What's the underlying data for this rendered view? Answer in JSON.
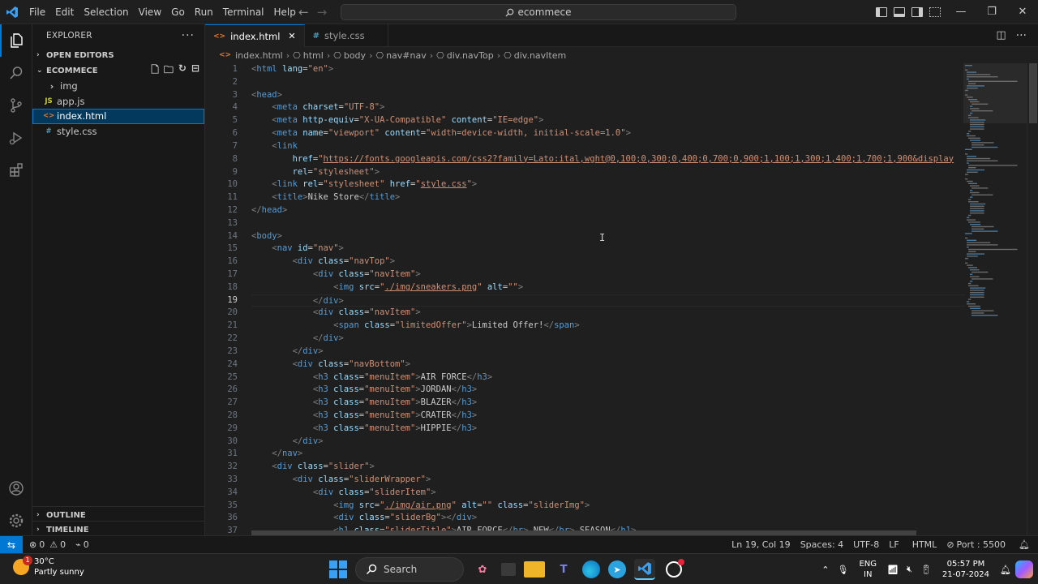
{
  "titlebar": {
    "menu": [
      "File",
      "Edit",
      "Selection",
      "View",
      "Go",
      "Run",
      "Terminal",
      "Help"
    ],
    "search_text": "ecommece",
    "window_controls": [
      "minimize-icon",
      "restore-icon",
      "close-icon"
    ]
  },
  "activity_bar": [
    "explorer-icon",
    "search-icon",
    "source-control-icon",
    "run-debug-icon",
    "extensions-icon",
    "account-icon",
    "settings-gear-icon"
  ],
  "sidebar": {
    "title": "EXPLORER",
    "open_editors": "OPEN EDITORS",
    "project": "ECOMMECE",
    "files": [
      {
        "name": "img",
        "kind": "folder"
      },
      {
        "name": "app.js",
        "kind": "js",
        "icon": "JS"
      },
      {
        "name": "index.html",
        "kind": "html",
        "icon": "<>"
      },
      {
        "name": "style.css",
        "kind": "css",
        "icon": "#"
      }
    ],
    "outline": "OUTLINE",
    "timeline": "TIMELINE"
  },
  "tabs": [
    {
      "label": "index.html",
      "icon": "<>",
      "active": true
    },
    {
      "label": "style.css",
      "icon": "#",
      "active": false
    }
  ],
  "breadcrumb": [
    "index.html",
    "html",
    "body",
    "nav#nav",
    "div.navTop",
    "div.navItem"
  ],
  "editor": {
    "current_line": 19,
    "lines": [
      [
        [
          "t",
          "<"
        ],
        [
          "n",
          "html"
        ],
        [
          "x",
          " "
        ],
        [
          "a",
          "lang"
        ],
        [
          "x",
          "="
        ],
        [
          "s",
          "\"en\""
        ],
        [
          "t",
          ">"
        ]
      ],
      [],
      [
        [
          "t",
          "<"
        ],
        [
          "n",
          "head"
        ],
        [
          "t",
          ">"
        ]
      ],
      [
        [
          "x",
          "    "
        ],
        [
          "t",
          "<"
        ],
        [
          "n",
          "meta"
        ],
        [
          "x",
          " "
        ],
        [
          "a",
          "charset"
        ],
        [
          "x",
          "="
        ],
        [
          "s",
          "\"UTF-8\""
        ],
        [
          "t",
          ">"
        ]
      ],
      [
        [
          "x",
          "    "
        ],
        [
          "t",
          "<"
        ],
        [
          "n",
          "meta"
        ],
        [
          "x",
          " "
        ],
        [
          "a",
          "http-equiv"
        ],
        [
          "x",
          "="
        ],
        [
          "s",
          "\"X-UA-Compatible\""
        ],
        [
          "x",
          " "
        ],
        [
          "a",
          "content"
        ],
        [
          "x",
          "="
        ],
        [
          "s",
          "\"IE=edge\""
        ],
        [
          "t",
          ">"
        ]
      ],
      [
        [
          "x",
          "    "
        ],
        [
          "t",
          "<"
        ],
        [
          "n",
          "meta"
        ],
        [
          "x",
          " "
        ],
        [
          "a",
          "name"
        ],
        [
          "x",
          "="
        ],
        [
          "s",
          "\"viewport\""
        ],
        [
          "x",
          " "
        ],
        [
          "a",
          "content"
        ],
        [
          "x",
          "="
        ],
        [
          "s",
          "\"width=device-width, initial-scale=1.0\""
        ],
        [
          "t",
          ">"
        ]
      ],
      [
        [
          "x",
          "    "
        ],
        [
          "t",
          "<"
        ],
        [
          "n",
          "link"
        ]
      ],
      [
        [
          "x",
          "        "
        ],
        [
          "a",
          "href"
        ],
        [
          "x",
          "="
        ],
        [
          "s",
          "\""
        ],
        [
          "u",
          "https://fonts.googleapis.com/css2?family=Lato:ital,wght@0,100;0,300;0,400;0,700;0,900;1,100;1,300;1,400;1,700;1,900&display"
        ]
      ],
      [
        [
          "x",
          "        "
        ],
        [
          "a",
          "rel"
        ],
        [
          "x",
          "="
        ],
        [
          "s",
          "\"stylesheet\""
        ],
        [
          "t",
          ">"
        ]
      ],
      [
        [
          "x",
          "    "
        ],
        [
          "t",
          "<"
        ],
        [
          "n",
          "link"
        ],
        [
          "x",
          " "
        ],
        [
          "a",
          "rel"
        ],
        [
          "x",
          "="
        ],
        [
          "s",
          "\"stylesheet\""
        ],
        [
          "x",
          " "
        ],
        [
          "a",
          "href"
        ],
        [
          "x",
          "="
        ],
        [
          "s",
          "\""
        ],
        [
          "u",
          "style.css"
        ],
        [
          "s",
          "\""
        ],
        [
          "t",
          ">"
        ]
      ],
      [
        [
          "x",
          "    "
        ],
        [
          "t",
          "<"
        ],
        [
          "n",
          "title"
        ],
        [
          "t",
          ">"
        ],
        [
          "x",
          "Nike Store"
        ],
        [
          "t",
          "</"
        ],
        [
          "n",
          "title"
        ],
        [
          "t",
          ">"
        ]
      ],
      [
        [
          "t",
          "</"
        ],
        [
          "n",
          "head"
        ],
        [
          "t",
          ">"
        ]
      ],
      [],
      [
        [
          "t",
          "<"
        ],
        [
          "n",
          "body"
        ],
        [
          "t",
          ">"
        ]
      ],
      [
        [
          "x",
          "    "
        ],
        [
          "t",
          "<"
        ],
        [
          "n",
          "nav"
        ],
        [
          "x",
          " "
        ],
        [
          "a",
          "id"
        ],
        [
          "x",
          "="
        ],
        [
          "s",
          "\"nav\""
        ],
        [
          "t",
          ">"
        ]
      ],
      [
        [
          "x",
          "        "
        ],
        [
          "t",
          "<"
        ],
        [
          "n",
          "div"
        ],
        [
          "x",
          " "
        ],
        [
          "a",
          "class"
        ],
        [
          "x",
          "="
        ],
        [
          "s",
          "\"navTop\""
        ],
        [
          "t",
          ">"
        ]
      ],
      [
        [
          "x",
          "            "
        ],
        [
          "t",
          "<"
        ],
        [
          "n",
          "div"
        ],
        [
          "x",
          " "
        ],
        [
          "a",
          "class"
        ],
        [
          "x",
          "="
        ],
        [
          "s",
          "\"navItem\""
        ],
        [
          "t",
          ">"
        ]
      ],
      [
        [
          "x",
          "                "
        ],
        [
          "t",
          "<"
        ],
        [
          "n",
          "img"
        ],
        [
          "x",
          " "
        ],
        [
          "a",
          "src"
        ],
        [
          "x",
          "="
        ],
        [
          "s",
          "\""
        ],
        [
          "u",
          "./img/sneakers.png"
        ],
        [
          "s",
          "\""
        ],
        [
          "x",
          " "
        ],
        [
          "a",
          "alt"
        ],
        [
          "x",
          "="
        ],
        [
          "s",
          "\"\""
        ],
        [
          "t",
          ">"
        ]
      ],
      [
        [
          "x",
          "            "
        ],
        [
          "t",
          "</"
        ],
        [
          "n",
          "div"
        ],
        [
          "t",
          ">"
        ]
      ],
      [
        [
          "x",
          "            "
        ],
        [
          "t",
          "<"
        ],
        [
          "n",
          "div"
        ],
        [
          "x",
          " "
        ],
        [
          "a",
          "class"
        ],
        [
          "x",
          "="
        ],
        [
          "s",
          "\"navItem\""
        ],
        [
          "t",
          ">"
        ]
      ],
      [
        [
          "x",
          "                "
        ],
        [
          "t",
          "<"
        ],
        [
          "n",
          "span"
        ],
        [
          "x",
          " "
        ],
        [
          "a",
          "class"
        ],
        [
          "x",
          "="
        ],
        [
          "s",
          "\"limitedOffer\""
        ],
        [
          "t",
          ">"
        ],
        [
          "x",
          "Limited Offer!"
        ],
        [
          "t",
          "</"
        ],
        [
          "n",
          "span"
        ],
        [
          "t",
          ">"
        ]
      ],
      [
        [
          "x",
          "            "
        ],
        [
          "t",
          "</"
        ],
        [
          "n",
          "div"
        ],
        [
          "t",
          ">"
        ]
      ],
      [
        [
          "x",
          "        "
        ],
        [
          "t",
          "</"
        ],
        [
          "n",
          "div"
        ],
        [
          "t",
          ">"
        ]
      ],
      [
        [
          "x",
          "        "
        ],
        [
          "t",
          "<"
        ],
        [
          "n",
          "div"
        ],
        [
          "x",
          " "
        ],
        [
          "a",
          "class"
        ],
        [
          "x",
          "="
        ],
        [
          "s",
          "\"navBottom\""
        ],
        [
          "t",
          ">"
        ]
      ],
      [
        [
          "x",
          "            "
        ],
        [
          "t",
          "<"
        ],
        [
          "n",
          "h3"
        ],
        [
          "x",
          " "
        ],
        [
          "a",
          "class"
        ],
        [
          "x",
          "="
        ],
        [
          "s",
          "\"menuItem\""
        ],
        [
          "t",
          ">"
        ],
        [
          "x",
          "AIR FORCE"
        ],
        [
          "t",
          "</"
        ],
        [
          "n",
          "h3"
        ],
        [
          "t",
          ">"
        ]
      ],
      [
        [
          "x",
          "            "
        ],
        [
          "t",
          "<"
        ],
        [
          "n",
          "h3"
        ],
        [
          "x",
          " "
        ],
        [
          "a",
          "class"
        ],
        [
          "x",
          "="
        ],
        [
          "s",
          "\"menuItem\""
        ],
        [
          "t",
          ">"
        ],
        [
          "x",
          "JORDAN"
        ],
        [
          "t",
          "</"
        ],
        [
          "n",
          "h3"
        ],
        [
          "t",
          ">"
        ]
      ],
      [
        [
          "x",
          "            "
        ],
        [
          "t",
          "<"
        ],
        [
          "n",
          "h3"
        ],
        [
          "x",
          " "
        ],
        [
          "a",
          "class"
        ],
        [
          "x",
          "="
        ],
        [
          "s",
          "\"menuItem\""
        ],
        [
          "t",
          ">"
        ],
        [
          "x",
          "BLAZER"
        ],
        [
          "t",
          "</"
        ],
        [
          "n",
          "h3"
        ],
        [
          "t",
          ">"
        ]
      ],
      [
        [
          "x",
          "            "
        ],
        [
          "t",
          "<"
        ],
        [
          "n",
          "h3"
        ],
        [
          "x",
          " "
        ],
        [
          "a",
          "class"
        ],
        [
          "x",
          "="
        ],
        [
          "s",
          "\"menuItem\""
        ],
        [
          "t",
          ">"
        ],
        [
          "x",
          "CRATER"
        ],
        [
          "t",
          "</"
        ],
        [
          "n",
          "h3"
        ],
        [
          "t",
          ">"
        ]
      ],
      [
        [
          "x",
          "            "
        ],
        [
          "t",
          "<"
        ],
        [
          "n",
          "h3"
        ],
        [
          "x",
          " "
        ],
        [
          "a",
          "class"
        ],
        [
          "x",
          "="
        ],
        [
          "s",
          "\"menuItem\""
        ],
        [
          "t",
          ">"
        ],
        [
          "x",
          "HIPPIE"
        ],
        [
          "t",
          "</"
        ],
        [
          "n",
          "h3"
        ],
        [
          "t",
          ">"
        ]
      ],
      [
        [
          "x",
          "        "
        ],
        [
          "t",
          "</"
        ],
        [
          "n",
          "div"
        ],
        [
          "t",
          ">"
        ]
      ],
      [
        [
          "x",
          "    "
        ],
        [
          "t",
          "</"
        ],
        [
          "n",
          "nav"
        ],
        [
          "t",
          ">"
        ]
      ],
      [
        [
          "x",
          "    "
        ],
        [
          "t",
          "<"
        ],
        [
          "n",
          "div"
        ],
        [
          "x",
          " "
        ],
        [
          "a",
          "class"
        ],
        [
          "x",
          "="
        ],
        [
          "s",
          "\"slider\""
        ],
        [
          "t",
          ">"
        ]
      ],
      [
        [
          "x",
          "        "
        ],
        [
          "t",
          "<"
        ],
        [
          "n",
          "div"
        ],
        [
          "x",
          " "
        ],
        [
          "a",
          "class"
        ],
        [
          "x",
          "="
        ],
        [
          "s",
          "\"sliderWrapper\""
        ],
        [
          "t",
          ">"
        ]
      ],
      [
        [
          "x",
          "            "
        ],
        [
          "t",
          "<"
        ],
        [
          "n",
          "div"
        ],
        [
          "x",
          " "
        ],
        [
          "a",
          "class"
        ],
        [
          "x",
          "="
        ],
        [
          "s",
          "\"sliderItem\""
        ],
        [
          "t",
          ">"
        ]
      ],
      [
        [
          "x",
          "                "
        ],
        [
          "t",
          "<"
        ],
        [
          "n",
          "img"
        ],
        [
          "x",
          " "
        ],
        [
          "a",
          "src"
        ],
        [
          "x",
          "="
        ],
        [
          "s",
          "\""
        ],
        [
          "u",
          "./img/air.png"
        ],
        [
          "s",
          "\""
        ],
        [
          "x",
          " "
        ],
        [
          "a",
          "alt"
        ],
        [
          "x",
          "="
        ],
        [
          "s",
          "\"\""
        ],
        [
          "x",
          " "
        ],
        [
          "a",
          "class"
        ],
        [
          "x",
          "="
        ],
        [
          "s",
          "\"sliderImg\""
        ],
        [
          "t",
          ">"
        ]
      ],
      [
        [
          "x",
          "                "
        ],
        [
          "t",
          "<"
        ],
        [
          "n",
          "div"
        ],
        [
          "x",
          " "
        ],
        [
          "a",
          "class"
        ],
        [
          "x",
          "="
        ],
        [
          "s",
          "\"sliderBg\""
        ],
        [
          "t",
          "></"
        ],
        [
          "n",
          "div"
        ],
        [
          "t",
          ">"
        ]
      ],
      [
        [
          "x",
          "                "
        ],
        [
          "t",
          "<"
        ],
        [
          "n",
          "h1"
        ],
        [
          "x",
          " "
        ],
        [
          "a",
          "class"
        ],
        [
          "x",
          "="
        ],
        [
          "s",
          "\"sliderTitle\""
        ],
        [
          "t",
          ">"
        ],
        [
          "x",
          "AIR FORCE"
        ],
        [
          "t",
          "</"
        ],
        [
          "n",
          "br"
        ],
        [
          "t",
          ">"
        ],
        [
          "x",
          " NEW"
        ],
        [
          "t",
          "</"
        ],
        [
          "n",
          "br"
        ],
        [
          "t",
          ">"
        ],
        [
          "x",
          " SEASON"
        ],
        [
          "t",
          "</"
        ],
        [
          "n",
          "h1"
        ],
        [
          "t",
          ">"
        ]
      ]
    ]
  },
  "statusbar": {
    "errors": "0",
    "warnings": "0",
    "ports": "0",
    "position": "Ln 19, Col 19",
    "spaces": "Spaces: 4",
    "encoding": "UTF-8",
    "eol": "LF",
    "language": "HTML",
    "port": "Port : 5500"
  },
  "taskbar": {
    "weather_temp": "30°C",
    "weather_desc": "Partly sunny",
    "weather_badge": "1",
    "search": "Search",
    "lang_line1": "ENG",
    "lang_line2": "IN",
    "time": "05:57 PM",
    "date": "21-07-2024"
  },
  "colors": {
    "accent": "#0078d4",
    "tag": "#569cd6",
    "attribute": "#9cdcfe",
    "string": "#ce9178"
  }
}
